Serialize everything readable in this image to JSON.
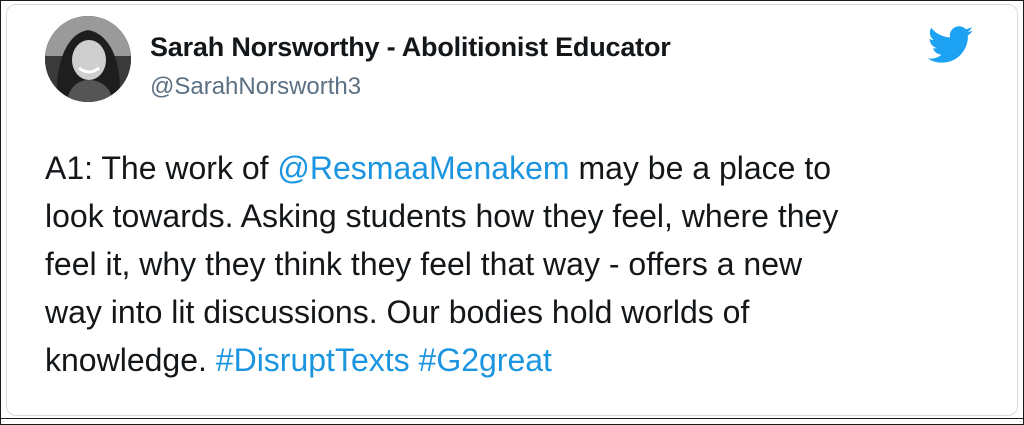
{
  "user": {
    "display_name": "Sarah Norsworthy - Abolitionist Educator",
    "handle": "@SarahNorsworth3",
    "avatar_icon": "user-photo"
  },
  "brand": {
    "icon": "twitter-bird-icon",
    "color": "#1DA1F2"
  },
  "tweet": {
    "line1": {
      "a": "A1: The work of ",
      "mention": "@ResmaaMenakem",
      "b": " may be a place to"
    },
    "line2": "look towards.  Asking students how they feel, where they",
    "line3": "feel it, why they think they feel that way - offers a new",
    "line4": "way into lit discussions.  Our bodies hold worlds of",
    "line5": {
      "a": "knowledge. ",
      "hashtag1": "#DisruptTexts",
      "hashtag2": "#G2great"
    }
  },
  "colors": {
    "link": "#1b95e0",
    "text": "#14171a",
    "muted": "#5b7083"
  }
}
